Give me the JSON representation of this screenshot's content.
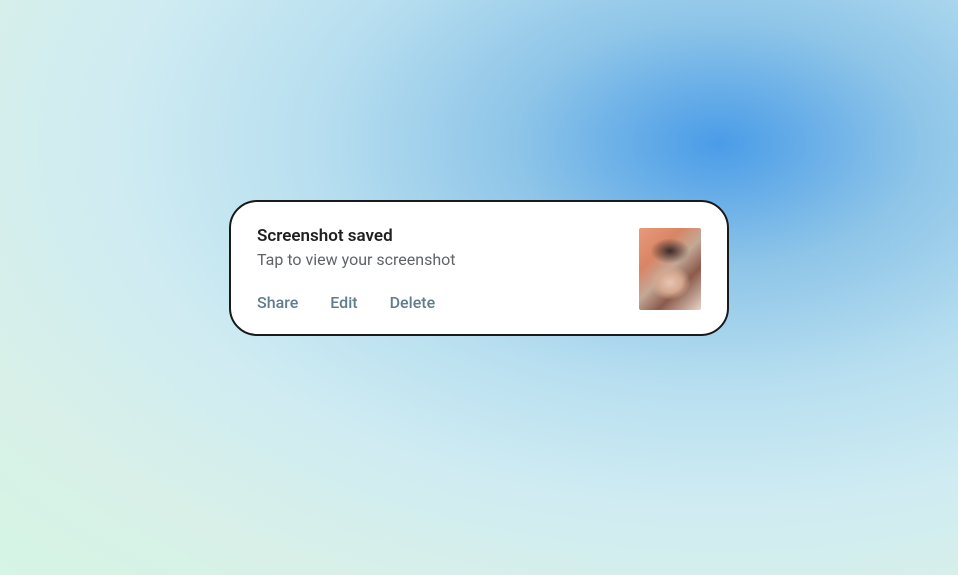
{
  "notification": {
    "title": "Screenshot saved",
    "subtitle": "Tap to view your screenshot",
    "actions": {
      "share": "Share",
      "edit": "Edit",
      "delete": "Delete"
    }
  }
}
